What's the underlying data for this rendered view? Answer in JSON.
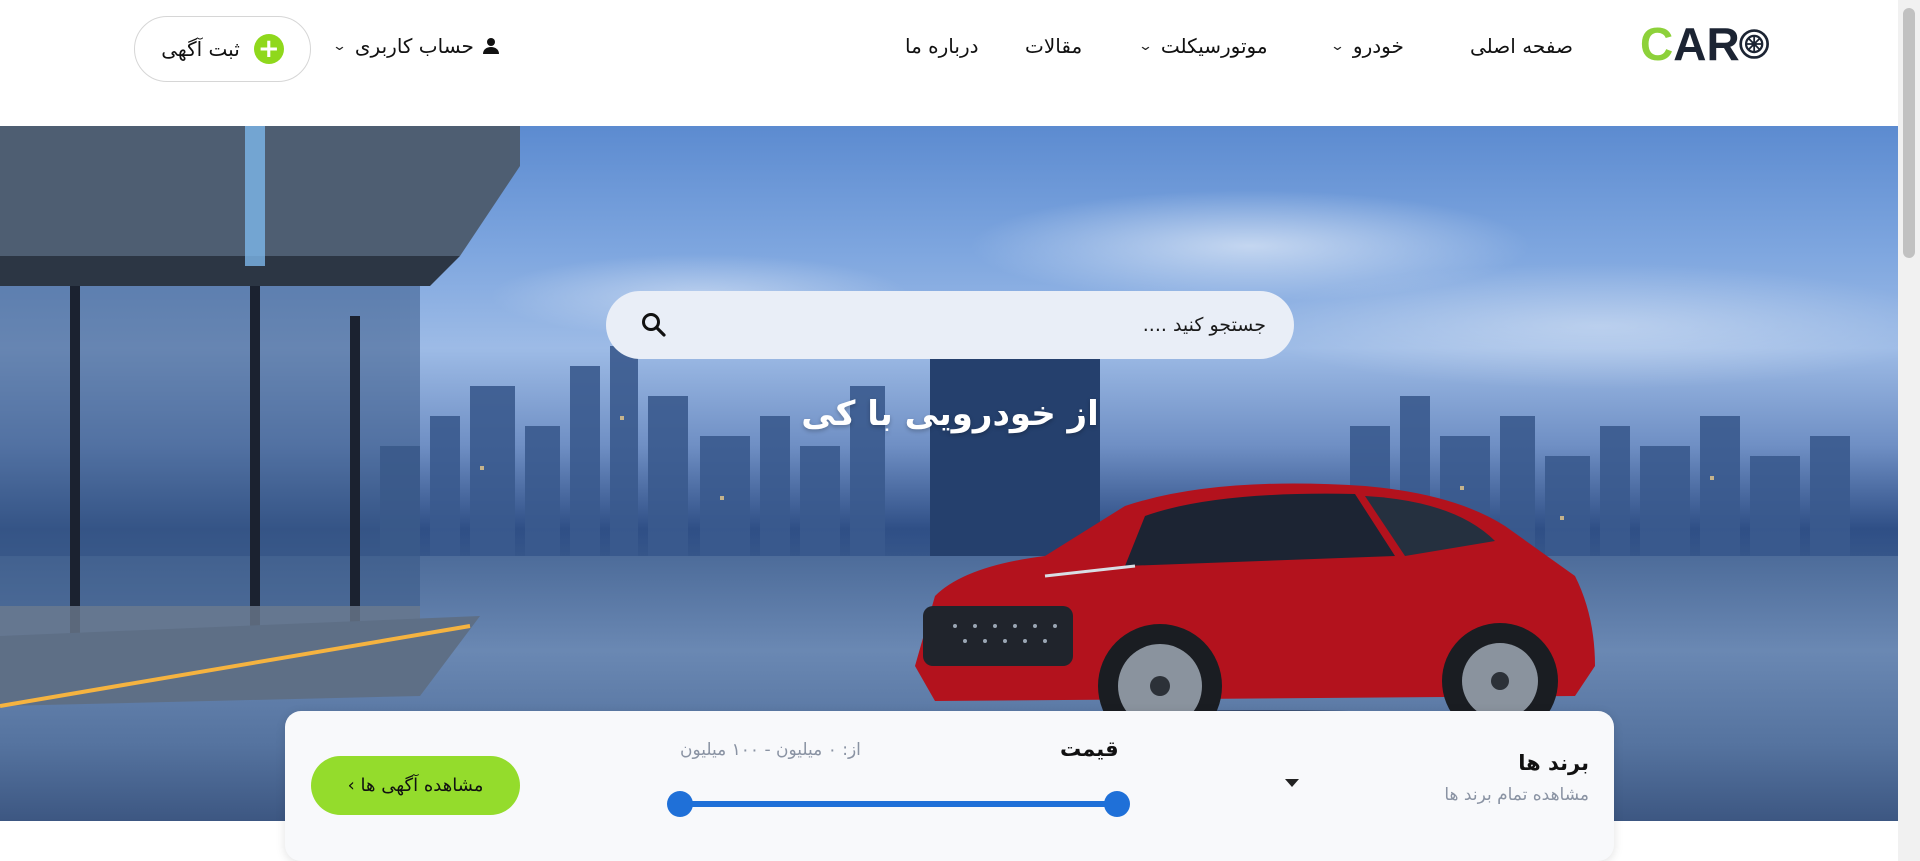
{
  "header": {
    "logo_c": "C",
    "logo_ar": "AR",
    "nav": {
      "home": "صفحه اصلی",
      "car": "خودرو",
      "motorcycle": "موتورسیکلت",
      "articles": "مقالات",
      "about": "درباره ما"
    },
    "account": "حساب کاربری",
    "post_ad": "ثبت آگهی"
  },
  "hero": {
    "search_placeholder": "جستجو کنید ....",
    "headline": "از خودرویی با کی"
  },
  "filter": {
    "brands_title": "برند ها",
    "brands_subtitle": "مشاهده تمام برند ها",
    "price_title": "قیمت",
    "price_range": "از: ۰ میلیون - ۱۰۰ میلیون",
    "price_min_fraction": 0,
    "price_max_fraction": 1,
    "view_ads": "مشاهده آگهی ها ›"
  },
  "colors": {
    "accent_green": "#8fd81c",
    "slider_blue": "#1f70d8",
    "logo_dark": "#1c2433"
  },
  "icons": {
    "search": "search-icon",
    "user": "user-icon",
    "plus": "plus-icon",
    "chevron": "chevron-down-icon"
  }
}
